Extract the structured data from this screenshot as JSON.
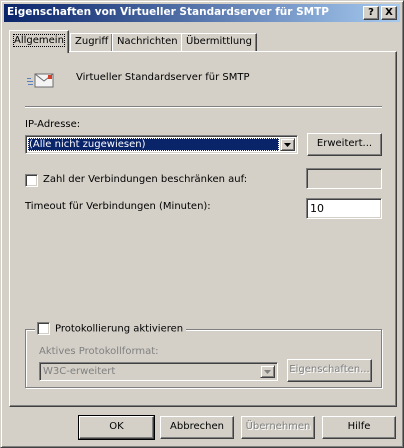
{
  "window": {
    "title": "Eigenschaften von Virtueller Standardserver für SMTP",
    "help_label": "?",
    "close_label": "X"
  },
  "tabs": [
    {
      "label": "Allgemein",
      "active": true
    },
    {
      "label": "Zugriff",
      "active": false
    },
    {
      "label": "Nachrichten",
      "active": false
    },
    {
      "label": "Übermittlung",
      "active": false
    }
  ],
  "general": {
    "server_name": "Virtueller Standardserver für SMTP",
    "ip_label": "IP-Adresse:",
    "ip_value": "(Alle nicht zugewiesen)",
    "advanced_button": "Erweitert...",
    "limit_connections_label": "Zahl der Verbindungen beschränken auf:",
    "limit_connections_checked": false,
    "limit_connections_value": "",
    "timeout_label": "Timeout für Verbindungen (Minuten):",
    "timeout_value": "10"
  },
  "logging": {
    "enable_label": "Protokollierung aktivieren",
    "enabled": false,
    "format_label": "Aktives Protokollformat:",
    "format_value": "W3C-erweitert",
    "properties_button": "Eigenschaften..."
  },
  "footer": {
    "ok": "OK",
    "cancel": "Abbrechen",
    "apply": "Übernehmen",
    "help": "Hilfe"
  },
  "colors": {
    "title_gradient_start": "#0a246a",
    "title_gradient_end": "#a6caf0",
    "face": "#d4d0c8",
    "selection": "#0a246a"
  }
}
